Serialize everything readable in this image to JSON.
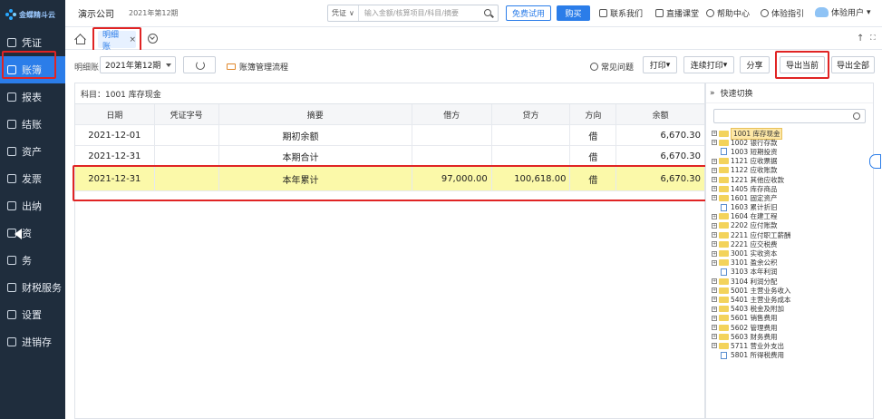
{
  "sidebar": {
    "logo_text": "金蝶精斗云",
    "items": [
      {
        "label": "凭证",
        "icon": "voucher-icon"
      },
      {
        "label": "账簿",
        "icon": "ledger-icon",
        "active": true
      },
      {
        "label": "报表",
        "icon": "report-icon"
      },
      {
        "label": "结账",
        "icon": "close-books-icon"
      },
      {
        "label": "资产",
        "icon": "assets-icon"
      },
      {
        "label": "发票",
        "icon": "invoice-icon"
      },
      {
        "label": "出纳",
        "icon": "cashier-icon"
      },
      {
        "label": "资",
        "icon": "capital-icon"
      },
      {
        "label": "务",
        "icon": "tax-icon"
      },
      {
        "label": "财税服务",
        "icon": "tax-service-icon"
      },
      {
        "label": "设置",
        "icon": "settings-icon"
      },
      {
        "label": "进销存",
        "icon": "inventory-icon"
      }
    ]
  },
  "header": {
    "company": "演示公司",
    "period": "2021年第12期",
    "search_select": "凭证",
    "search_placeholder": "输入金额/核算项目/科目/摘要",
    "trial_button": "免费试用",
    "buy_button": "购买",
    "links": [
      "联系我们",
      "直播课堂",
      "帮助中心",
      "体验指引"
    ],
    "user": "体验用户"
  },
  "tabs": [
    {
      "label": "明细账",
      "close": "×"
    }
  ],
  "toolbar": {
    "label": "明细账",
    "period": "2021年第12期",
    "video_link": "账簿管理流程",
    "faq": "常见问题",
    "print": "打印",
    "batch_print": "连续打印",
    "share": "分享",
    "export_current": "导出当前",
    "export_all": "导出全部"
  },
  "ledger": {
    "subject": "科目：1001 库存现金",
    "columns": [
      "日期",
      "凭证字号",
      "摘要",
      "借方",
      "贷方",
      "方向",
      "余额"
    ],
    "rows": [
      {
        "date": "2021-12-01",
        "voucher": "",
        "summary": "期初余额",
        "debit": "",
        "credit": "",
        "dir": "借",
        "balance": "6,670.30"
      },
      {
        "date": "2021-12-31",
        "voucher": "",
        "summary": "本期合计",
        "debit": "",
        "credit": "",
        "dir": "借",
        "balance": "6,670.30"
      },
      {
        "date": "2021-12-31",
        "voucher": "",
        "summary": "本年累计",
        "debit": "97,000.00",
        "credit": "100,618.00",
        "dir": "借",
        "balance": "6,670.30"
      }
    ]
  },
  "quick_switch": {
    "title": "快速切换",
    "accounts": [
      {
        "label": "1001 库存现金",
        "type": "folder",
        "expand": "+",
        "selected": true
      },
      {
        "label": "1002 银行存款",
        "type": "folder",
        "expand": "+"
      },
      {
        "label": "1003 短期投资",
        "type": "file"
      },
      {
        "label": "1121 应收票据",
        "type": "folder",
        "expand": "+"
      },
      {
        "label": "1122 应收账款",
        "type": "folder",
        "expand": "+"
      },
      {
        "label": "1221 其他应收款",
        "type": "folder",
        "expand": "+"
      },
      {
        "label": "1405 库存商品",
        "type": "folder",
        "expand": "+"
      },
      {
        "label": "1601 固定资产",
        "type": "folder",
        "expand": "+"
      },
      {
        "label": "1603 累计折旧",
        "type": "file"
      },
      {
        "label": "1604 在建工程",
        "type": "folder",
        "expand": "+"
      },
      {
        "label": "2202 应付账款",
        "type": "folder",
        "expand": "+"
      },
      {
        "label": "2211 应付职工薪酬",
        "type": "folder",
        "expand": "+"
      },
      {
        "label": "2221 应交税费",
        "type": "folder",
        "expand": "+"
      },
      {
        "label": "3001 实收资本",
        "type": "folder",
        "expand": "+"
      },
      {
        "label": "3101 盈余公积",
        "type": "folder",
        "expand": "+"
      },
      {
        "label": "3103 本年利润",
        "type": "file"
      },
      {
        "label": "3104 利润分配",
        "type": "folder",
        "expand": "+"
      },
      {
        "label": "5001 主营业务收入",
        "type": "folder",
        "expand": "+"
      },
      {
        "label": "5401 主营业务成本",
        "type": "folder",
        "expand": "+"
      },
      {
        "label": "5403 税金及附加",
        "type": "folder",
        "expand": "+"
      },
      {
        "label": "5601 销售费用",
        "type": "folder",
        "expand": "+"
      },
      {
        "label": "5602 管理费用",
        "type": "folder",
        "expand": "+"
      },
      {
        "label": "5603 财务费用",
        "type": "folder",
        "expand": "+"
      },
      {
        "label": "5711 营业外支出",
        "type": "folder",
        "expand": "+"
      },
      {
        "label": "5801 所得税费用",
        "type": "file"
      }
    ]
  }
}
